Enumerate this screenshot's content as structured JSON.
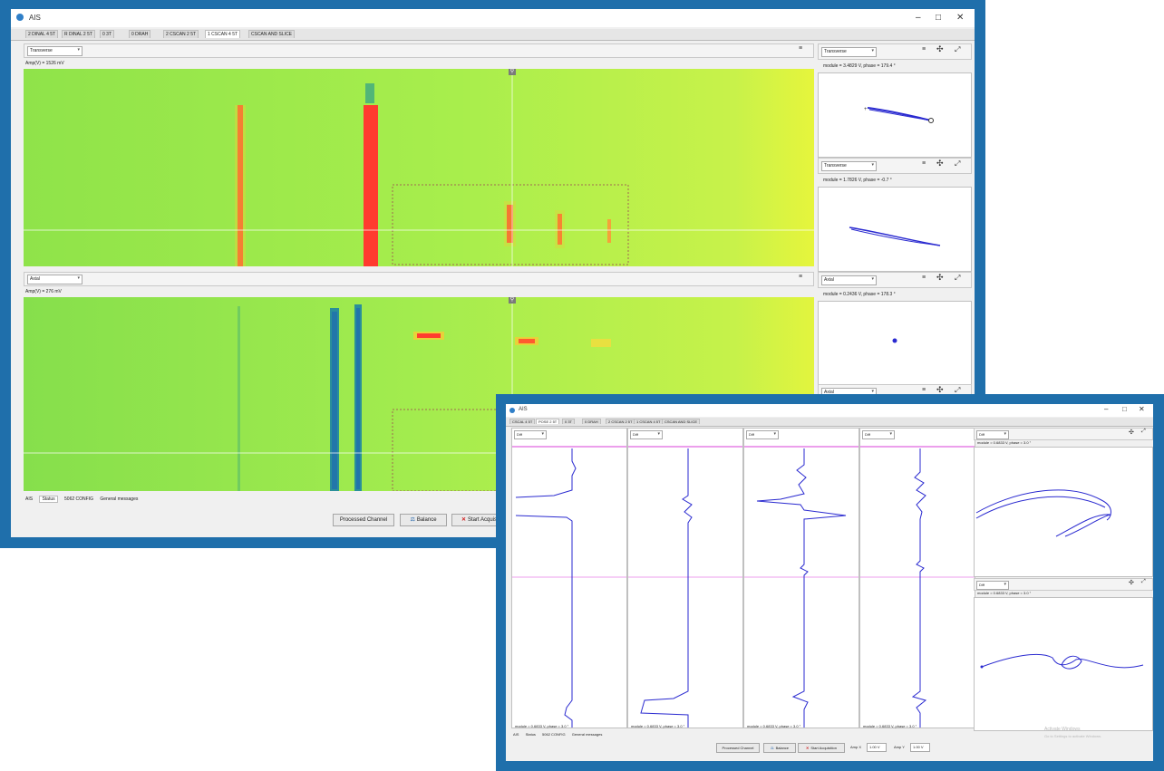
{
  "win1": {
    "title": "AIS",
    "tabs": [
      "2 DINAL 4 5T",
      "R DINAL 2 5T",
      "0 3T",
      "0 DRAH",
      "2 CSCAN 2 5T",
      "1 CSCAN 4 5T",
      "CSCAN AND SLICE"
    ],
    "active_tab": 5,
    "panel_top": {
      "dropdown": "Transverse",
      "amp": "Amp(V) = 1526 mV"
    },
    "panel_bottom": {
      "dropdown": "Axial",
      "amp": "Amp(V) = 276 mV"
    },
    "side_panels": [
      {
        "dropdown": "Transverse",
        "readout": "module = 3.4829 V, phase = 179.4 °"
      },
      {
        "dropdown": "Transverse",
        "readout": "module = 1.7826 V, phase = -0.7 °"
      },
      {
        "dropdown": "Axial",
        "readout": "module = 0.2436 V, phase = 178.3 °"
      },
      {
        "dropdown": "Axial"
      }
    ],
    "status_tabs": [
      "AIS",
      "Status",
      "5062 CONFIG",
      "General messages"
    ],
    "buttons": {
      "processed": "Processed Channel",
      "balance": "Balance",
      "start": "Start Acquisition"
    }
  },
  "win2": {
    "title": "AIS",
    "tabs": [
      "CSCAL 4 5T",
      "POSE 2 5T",
      "0 3T",
      "0 DRAH",
      "2 CSCAN 2 5T",
      "1 CSCAN 4 5T",
      "CSCAN AND SLICE"
    ],
    "active_tab": 1,
    "channels": [
      "Diff",
      "Diff",
      "Diff",
      "Diff"
    ],
    "channel_readouts": [
      "module = 0.6833 V, phase = 3.0 °",
      "module = 0.6833 V, phase = 3.0 °",
      "module = 0.6833 V, phase = 3.0 °",
      "module = 0.6833 V, phase = 3.0 °"
    ],
    "lissajous": [
      {
        "dropdown": "Diff",
        "readout": "module = 0.6833 V, phase = 3.0 °"
      },
      {
        "dropdown": "Diff",
        "readout": "module = 0.6833 V, phase = 3.0 °"
      }
    ],
    "status_tabs": [
      "AIS",
      "Status",
      "5062 CONFIG",
      "General messages"
    ],
    "buttons": {
      "processed": "Processed Channel",
      "balance": "Balance",
      "start": "Start Acquisition"
    },
    "gain1": {
      "label": "Amp X",
      "value": "1.00 V"
    },
    "gain2": {
      "label": "Amp Y",
      "value": "1.00 V"
    },
    "watermark_1": "Activate Windows",
    "watermark_2": "Go to Settings to activate Windows."
  },
  "colors": {
    "frame": "#1f6fab",
    "heat_bg": "#9be84a",
    "hot": "#ff3b2f",
    "cold": "#1f6bb0",
    "trace": "#2a2ad0",
    "cursor": "#e060e0"
  },
  "icons": {
    "crosshair": "crosshair-icon",
    "expand": "expand-arrows-icon",
    "balance": "balance-icon",
    "stop": "stop-x-icon"
  }
}
